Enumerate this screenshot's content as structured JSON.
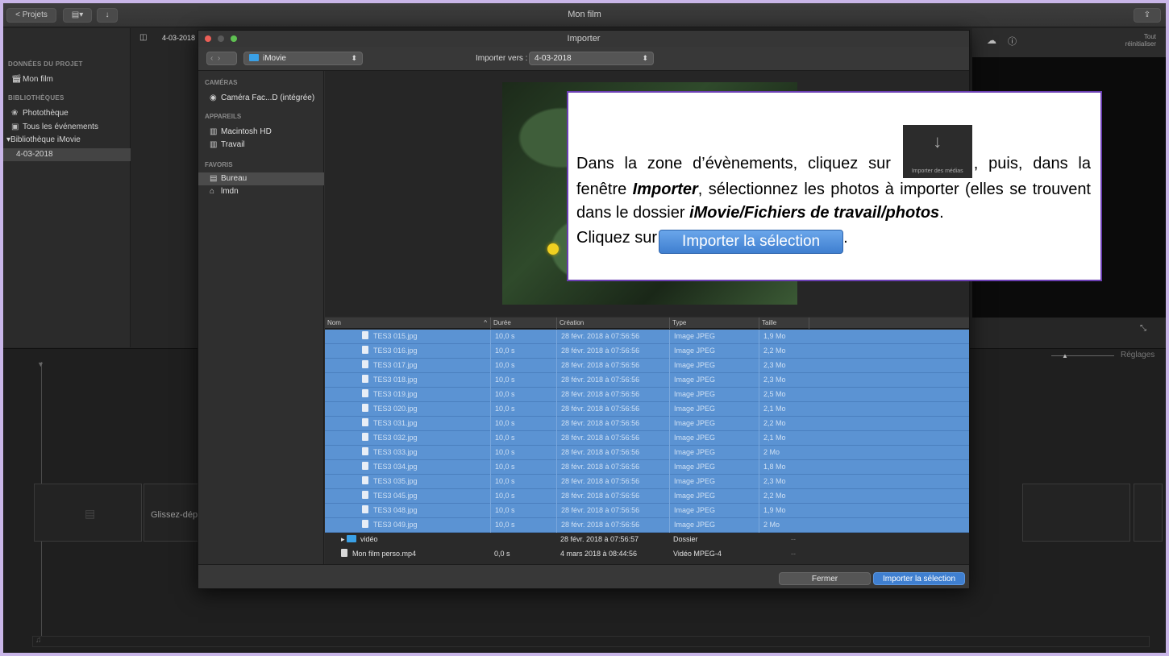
{
  "app": {
    "title": "Mon film",
    "projects_button": "< Projets",
    "share_icon": "share-icon"
  },
  "library": {
    "heading_project": "DONNÉES DU PROJET",
    "project_item": "Mon film",
    "heading_libraries": "BIBLIOTHÈQUES",
    "items": [
      "Photothèque",
      "Tous les événements",
      "Bibliothèque iMovie",
      "4-03-2018"
    ],
    "event_label": "4-03-2018"
  },
  "viewer": {
    "reset_label": "Tout\nréinitialiser",
    "settings_label": "Réglages"
  },
  "timeline": {
    "drop_hint": "Glissez-dép"
  },
  "dialog": {
    "title": "Importer",
    "source_popup": "iMovie",
    "import_to_label": "Importer vers :",
    "import_to_value": "4-03-2018",
    "sidebar": {
      "cameras_heading": "CAMÉRAS",
      "camera_item": "Caméra Fac...D (intégrée)",
      "devices_heading": "APPAREILS",
      "device_items": [
        "Macintosh HD",
        "Travail"
      ],
      "favorites_heading": "FAVORIS",
      "favorite_items": [
        "Bureau",
        "lmdn"
      ]
    },
    "table": {
      "columns": [
        "Nom",
        "Durée",
        "Création",
        "Type",
        "Taille"
      ],
      "selected_rows": [
        {
          "name": "TES3 015.jpg",
          "duration": "10,0 s",
          "created": "28 févr. 2018 à 07:56:56",
          "type": "Image JPEG",
          "size": "1,9 Mo"
        },
        {
          "name": "TES3 016.jpg",
          "duration": "10,0 s",
          "created": "28 févr. 2018 à 07:56:56",
          "type": "Image JPEG",
          "size": "2,2 Mo"
        },
        {
          "name": "TES3 017.jpg",
          "duration": "10,0 s",
          "created": "28 févr. 2018 à 07:56:56",
          "type": "Image JPEG",
          "size": "2,3 Mo"
        },
        {
          "name": "TES3 018.jpg",
          "duration": "10,0 s",
          "created": "28 févr. 2018 à 07:56:56",
          "type": "Image JPEG",
          "size": "2,3 Mo"
        },
        {
          "name": "TES3 019.jpg",
          "duration": "10,0 s",
          "created": "28 févr. 2018 à 07:56:56",
          "type": "Image JPEG",
          "size": "2,5 Mo"
        },
        {
          "name": "TES3 020.jpg",
          "duration": "10,0 s",
          "created": "28 févr. 2018 à 07:56:56",
          "type": "Image JPEG",
          "size": "2,1 Mo"
        },
        {
          "name": "TES3 031.jpg",
          "duration": "10,0 s",
          "created": "28 févr. 2018 à 07:56:56",
          "type": "Image JPEG",
          "size": "2,2 Mo"
        },
        {
          "name": "TES3 032.jpg",
          "duration": "10,0 s",
          "created": "28 févr. 2018 à 07:56:56",
          "type": "Image JPEG",
          "size": "2,1 Mo"
        },
        {
          "name": "TES3 033.jpg",
          "duration": "10,0 s",
          "created": "28 févr. 2018 à 07:56:56",
          "type": "Image JPEG",
          "size": "2 Mo"
        },
        {
          "name": "TES3 034.jpg",
          "duration": "10,0 s",
          "created": "28 févr. 2018 à 07:56:56",
          "type": "Image JPEG",
          "size": "1,8 Mo"
        },
        {
          "name": "TES3 035.jpg",
          "duration": "10,0 s",
          "created": "28 févr. 2018 à 07:56:56",
          "type": "Image JPEG",
          "size": "2,3 Mo"
        },
        {
          "name": "TES3 045.jpg",
          "duration": "10,0 s",
          "created": "28 févr. 2018 à 07:56:56",
          "type": "Image JPEG",
          "size": "2,2 Mo"
        },
        {
          "name": "TES3 048.jpg",
          "duration": "10,0 s",
          "created": "28 févr. 2018 à 07:56:56",
          "type": "Image JPEG",
          "size": "1,9 Mo"
        },
        {
          "name": "TES3 049.jpg",
          "duration": "10,0 s",
          "created": "28 févr. 2018 à 07:56:56",
          "type": "Image JPEG",
          "size": "2 Mo"
        }
      ],
      "other_rows": [
        {
          "name": "vidéo",
          "duration": "",
          "created": "28 févr. 2018 à 07:56:57",
          "type": "Dossier",
          "size": "--"
        },
        {
          "name": "Mon film perso.mp4",
          "duration": "0,0 s",
          "created": "4 mars 2018 à 08:44:56",
          "type": "Vidéo MPEG-4",
          "size": "--"
        }
      ]
    },
    "close_button": "Fermer",
    "import_selection_button": "Importer la sélection"
  },
  "callout": {
    "line1": "Dans la zone d’évènements, cliquez sur",
    "import_media_label": "Importer des médias",
    "line2_pre": "puis, dans la fenêtre",
    "line2_bold": "Importer",
    "line2_post": ", sélectionnez les photos à importer (elles se trouvent dans le dossier",
    "folder_path": "iMovie/Fichiers de travail/photos",
    "line3": "Cliquez sur",
    "import_selection_label": "Importer la sélection"
  },
  "colors": {
    "selection": "#5b93d3",
    "callout_border": "#6b3fb3",
    "primary_button": "#3f7fd0"
  }
}
